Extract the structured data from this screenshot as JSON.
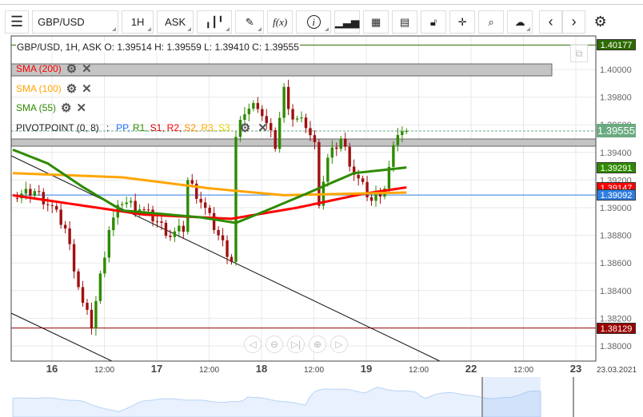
{
  "toolbar": {
    "menu_icon": "hamburger-icon",
    "symbol": "GBP/USD",
    "timeframe": "1H",
    "price_type": "ASK",
    "buttons": [
      "chart-type-icon",
      "draw-icon",
      "indicator-fx-icon",
      "info-icon",
      "volume-bars-icon",
      "calendar-icon",
      "report-icon",
      "lock-icon",
      "crosshair-icon",
      "zoom-chart-icon",
      "cloud-upload-icon",
      "prev-icon",
      "next-icon",
      "settings-icon"
    ],
    "fx_label": "f(x)",
    "info_label": "i"
  },
  "ohlc": "GBP/USD, 1H, ASK   O: 1.39514 H: 1.39559 L: 1.39410 C: 1.39555",
  "indicators": [
    {
      "label": "SMA (200)",
      "color": "#ff0000"
    },
    {
      "label": "SMA (100)",
      "color": "#ffa500"
    },
    {
      "label": "SMA (55)",
      "color": "#2e8b00"
    }
  ],
  "pivot": {
    "label": "PIVOTPOINT (0, 8)",
    "sep": ":",
    "items": [
      {
        "t": "PP,",
        "c": "#1e6fff"
      },
      {
        "t": "R1,",
        "c": "#2e8b00"
      },
      {
        "t": "S1,",
        "c": "#cc0000"
      },
      {
        "t": "R2,",
        "c": "#ff0000"
      },
      {
        "t": "S2,",
        "c": "#ff8c00"
      },
      {
        "t": "R3,",
        "c": "#ffb000"
      },
      {
        "t": "S3",
        "c": "#e6d000"
      }
    ]
  },
  "price_axis": [
    "1.40000",
    "1.39800",
    "1.39600",
    "1.39400",
    "1.39200",
    "1.39000",
    "1.38800",
    "1.38600",
    "1.38400",
    "1.38200",
    "1.38000"
  ],
  "price_labels": [
    {
      "v": "1.40177",
      "p": 1.40177,
      "bg": "#2e6b00"
    },
    {
      "v": "1.39555",
      "p": 1.39555,
      "bg": "#6aaa80"
    },
    {
      "v": "1.39291",
      "p": 1.39291,
      "bg": "#2e8b00"
    },
    {
      "v": "1.39147",
      "p": 1.39147,
      "bg": "#ff0000"
    },
    {
      "v": "1.39092",
      "p": 1.39092,
      "bg": "#2f7de1"
    },
    {
      "v": "1.38129",
      "p": 1.38129,
      "bg": "#990000"
    }
  ],
  "time_axis": [
    {
      "t": "16",
      "b": true
    },
    {
      "t": "12:00"
    },
    {
      "t": "17",
      "b": true
    },
    {
      "t": "12:00"
    },
    {
      "t": "18",
      "b": true
    },
    {
      "t": "12:00"
    },
    {
      "t": "19",
      "b": true
    },
    {
      "t": "12:00"
    },
    {
      "t": "22",
      "b": true
    },
    {
      "t": "12:00"
    },
    {
      "t": "23",
      "b": true
    }
  ],
  "date_label": "23.03.2021",
  "zoom_controls": [
    "scroll-left-icon",
    "zoom-out-icon",
    "scroll-end-icon",
    "zoom-in-icon",
    "scroll-right-icon"
  ],
  "price_keypoints": [
    [
      0,
      1.3907
    ],
    [
      5,
      1.3912
    ],
    [
      9,
      1.39
    ],
    [
      12,
      1.3885
    ],
    [
      16,
      1.383
    ],
    [
      18,
      1.3815
    ],
    [
      20,
      1.385
    ],
    [
      22,
      1.3885
    ],
    [
      25,
      1.3905
    ],
    [
      29,
      1.39
    ],
    [
      33,
      1.389
    ],
    [
      36,
      1.388
    ],
    [
      39,
      1.3885
    ],
    [
      40,
      1.392
    ],
    [
      43,
      1.3905
    ],
    [
      47,
      1.388
    ],
    [
      50,
      1.3862
    ],
    [
      51,
      1.395
    ],
    [
      53,
      1.397
    ],
    [
      56,
      1.3975
    ],
    [
      58,
      1.396
    ],
    [
      60,
      1.3945
    ],
    [
      62,
      1.3985
    ],
    [
      64,
      1.3965
    ],
    [
      67,
      1.396
    ],
    [
      69,
      1.3945
    ],
    [
      70,
      1.3905
    ],
    [
      72,
      1.3935
    ],
    [
      75,
      1.395
    ],
    [
      78,
      1.3925
    ],
    [
      80,
      1.3915
    ],
    [
      82,
      1.3905
    ],
    [
      85,
      1.3915
    ],
    [
      88,
      1.3955
    ],
    [
      90,
      1.39555
    ]
  ],
  "sma200": [
    [
      0,
      1.3909
    ],
    [
      30,
      1.3895
    ],
    [
      50,
      1.3892
    ],
    [
      65,
      1.39
    ],
    [
      80,
      1.391
    ],
    [
      90,
      1.39147
    ]
  ],
  "sma100": [
    [
      0,
      1.3925
    ],
    [
      25,
      1.3922
    ],
    [
      45,
      1.3914
    ],
    [
      62,
      1.3909
    ],
    [
      75,
      1.391
    ],
    [
      90,
      1.3911
    ]
  ],
  "sma55": [
    [
      0,
      1.3942
    ],
    [
      8,
      1.3932
    ],
    [
      16,
      1.3915
    ],
    [
      25,
      1.3898
    ],
    [
      43,
      1.3893
    ],
    [
      51,
      1.3889
    ],
    [
      58,
      1.3898
    ],
    [
      67,
      1.391
    ],
    [
      78,
      1.3925
    ],
    [
      90,
      1.39291
    ]
  ]
}
